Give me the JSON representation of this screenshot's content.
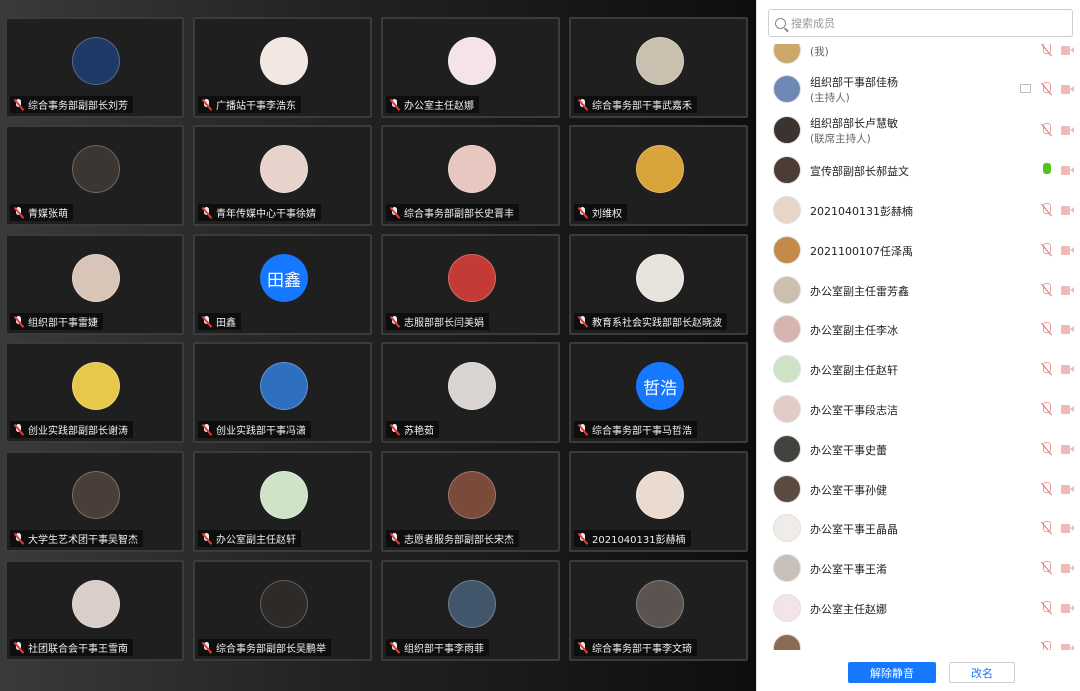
{
  "search": {
    "placeholder": "搜索成员"
  },
  "tiles": [
    {
      "name": "综合事务部副部长刘芳",
      "avatar": {
        "kind": "photo",
        "bg": "#1f3a66"
      }
    },
    {
      "name": "广播站干事李浩东",
      "avatar": {
        "kind": "photo",
        "bg": "#f3e7e2"
      }
    },
    {
      "name": "办公室主任赵娜",
      "avatar": {
        "kind": "photo",
        "bg": "#f5e3ea"
      }
    },
    {
      "name": "综合事务部干事武嘉禾",
      "avatar": {
        "kind": "photo",
        "bg": "#c9c0b0"
      }
    },
    {
      "name": "青媒张萌",
      "avatar": {
        "kind": "photo",
        "bg": "#3b3632"
      }
    },
    {
      "name": "青年传媒中心干事徐婧",
      "avatar": {
        "kind": "photo",
        "bg": "#e8d2cc"
      }
    },
    {
      "name": "综合事务部副部长史晋丰",
      "avatar": {
        "kind": "photo",
        "bg": "#e7c7c0"
      }
    },
    {
      "name": "刘维权",
      "avatar": {
        "kind": "photo",
        "bg": "#d9a43a"
      }
    },
    {
      "name": "组织部干事雷婕",
      "avatar": {
        "kind": "photo",
        "bg": "#d8c5b8"
      }
    },
    {
      "name": "田鑫",
      "avatar": {
        "kind": "text",
        "text": "田鑫",
        "bg": "#1677ff"
      }
    },
    {
      "name": "志服部部长闫美娟",
      "avatar": {
        "kind": "photo",
        "bg": "#c33a36"
      }
    },
    {
      "name": "教育系社会实践部部长赵晓波",
      "avatar": {
        "kind": "photo",
        "bg": "#e8e3dc"
      }
    },
    {
      "name": "创业实践部副部长谢涛",
      "avatar": {
        "kind": "photo",
        "bg": "#e8c84a"
      }
    },
    {
      "name": "创业实践部干事冯潇",
      "avatar": {
        "kind": "photo",
        "bg": "#2f6fc0"
      }
    },
    {
      "name": "苏艳茹",
      "avatar": {
        "kind": "photo",
        "bg": "#d9d3d2"
      }
    },
    {
      "name": "综合事务部干事马哲浩",
      "avatar": {
        "kind": "text",
        "text": "哲浩",
        "bg": "#1677ff"
      }
    },
    {
      "name": "大学生艺术团干事吴智杰",
      "avatar": {
        "kind": "photo",
        "bg": "#4a3f38"
      }
    },
    {
      "name": "办公室副主任赵轩",
      "avatar": {
        "kind": "photo",
        "bg": "#cfe3c8"
      }
    },
    {
      "name": "志愿者服务部副部长宋杰",
      "avatar": {
        "kind": "photo",
        "bg": "#7a4a3a"
      }
    },
    {
      "name": "2021040131彭赫楠",
      "avatar": {
        "kind": "photo",
        "bg": "#eadbd0"
      }
    },
    {
      "name": "社团联合会干事王雪南",
      "avatar": {
        "kind": "photo",
        "bg": "#d9cfc8"
      }
    },
    {
      "name": "综合事务部副部长吴鹏举",
      "avatar": {
        "kind": "photo",
        "bg": "#2e2a28"
      }
    },
    {
      "name": "组织部干事李雨菲",
      "avatar": {
        "kind": "photo",
        "bg": "#41566b"
      }
    },
    {
      "name": "综合事务部干事李文琦",
      "avatar": {
        "kind": "photo",
        "bg": "#5a5350"
      }
    }
  ],
  "members": [
    {
      "name": "",
      "sub": "(我)",
      "bg": "#c9a86a",
      "mic": "muted",
      "cam": true
    },
    {
      "name": "组织部干事部佳杨",
      "sub": "(主持人)",
      "bg": "#6e88b5",
      "mic": "muted",
      "cam": true,
      "screen": true
    },
    {
      "name": "组织部部长卢慧敏",
      "sub": "(联席主持人)",
      "bg": "#3a3330",
      "mic": "muted",
      "cam": true
    },
    {
      "name": "宣传部副部长郝益文",
      "sub": "",
      "bg": "#4b3d33",
      "mic": "on",
      "cam": true
    },
    {
      "name": "2021040131彭赫楠",
      "sub": "",
      "bg": "#e7d6c8",
      "mic": "muted",
      "cam": true
    },
    {
      "name": "2021100107任泽禹",
      "sub": "",
      "bg": "#c48a4a",
      "mic": "muted",
      "cam": true
    },
    {
      "name": "办公室副主任雷芳鑫",
      "sub": "",
      "bg": "#cdbfae",
      "mic": "muted",
      "cam": true
    },
    {
      "name": "办公室副主任李冰",
      "sub": "",
      "bg": "#d7b4b0",
      "mic": "muted",
      "cam": true
    },
    {
      "name": "办公室副主任赵轩",
      "sub": "",
      "bg": "#cfe3c8",
      "mic": "muted",
      "cam": true
    },
    {
      "name": "办公室干事段志洁",
      "sub": "",
      "bg": "#e2ccc6",
      "mic": "muted",
      "cam": true
    },
    {
      "name": "办公室干事史蕾",
      "sub": "",
      "bg": "#43423f",
      "mic": "muted",
      "cam": true
    },
    {
      "name": "办公室干事孙健",
      "sub": "",
      "bg": "#5b4a40",
      "mic": "muted",
      "cam": true
    },
    {
      "name": "办公室干事王晶晶",
      "sub": "",
      "bg": "#f0ece8",
      "mic": "muted",
      "cam": true
    },
    {
      "name": "办公室干事王淆",
      "sub": "",
      "bg": "#c8c0b8",
      "mic": "muted",
      "cam": true
    },
    {
      "name": "办公室主任赵娜",
      "sub": "",
      "bg": "#f5e3ea",
      "mic": "muted",
      "cam": true
    },
    {
      "name": "",
      "sub": "",
      "bg": "#8a6b55",
      "mic": "muted",
      "cam": true
    }
  ],
  "footer": {
    "unmute_label": "解除静音",
    "rename_label": "改名"
  }
}
